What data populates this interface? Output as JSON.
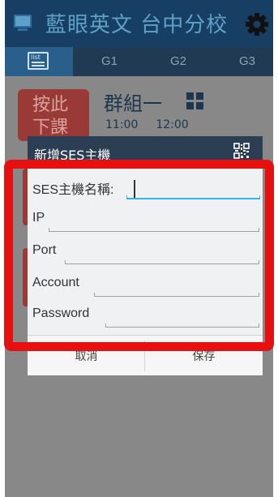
{
  "header": {
    "title": "藍眼英文 台中分校",
    "menu_icon": "monitor-icon",
    "settings_icon": "gear-icon",
    "color": "#163f63"
  },
  "tabs": {
    "list_label": "list",
    "items": [
      {
        "label": "G1"
      },
      {
        "label": "G2"
      },
      {
        "label": "G3"
      }
    ]
  },
  "background": {
    "button_label": "按此\n下課",
    "group_title": "群組一",
    "times": [
      "11:00",
      "12:00"
    ]
  },
  "dialog": {
    "title": "新增SES主機",
    "qr_icon": "qr-code-icon",
    "fields": [
      {
        "label": "SES主機名稱:",
        "value": "",
        "focused": true
      },
      {
        "label": "IP",
        "value": ""
      },
      {
        "label": "Port",
        "value": ""
      },
      {
        "label": "Account",
        "value": ""
      },
      {
        "label": "Password",
        "value": ""
      }
    ],
    "cancel_label": "取消",
    "save_label": "保存"
  },
  "highlight_color": "#e8100f"
}
